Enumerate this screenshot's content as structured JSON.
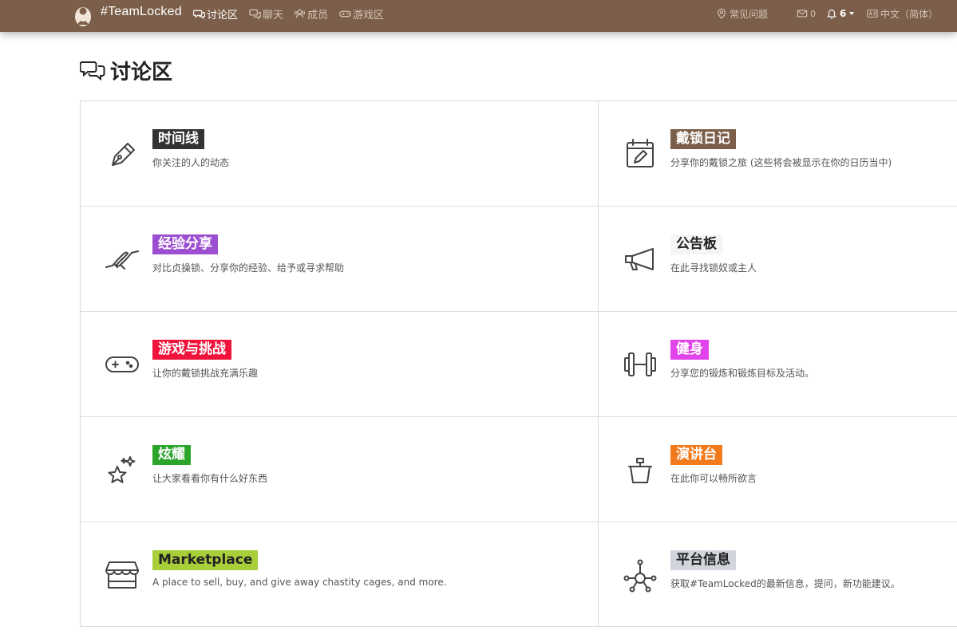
{
  "colors": {
    "topbar": "#7b5f4a",
    "nav_active": "#ffffff",
    "nav_inactive": "#d5c5b8"
  },
  "header": {
    "brand": "#TeamLocked",
    "logo_icon": "locked-person-icon",
    "nav": [
      {
        "label": "讨论区",
        "icon": "chat-bubbles-icon",
        "active": true
      },
      {
        "label": "聊天",
        "icon": "chat-icon",
        "active": false
      },
      {
        "label": "成员",
        "icon": "members-icon",
        "active": false
      },
      {
        "label": "游戏区",
        "icon": "gamepad-icon",
        "active": false
      }
    ],
    "faq": {
      "label": "常见问题",
      "icon": "map-pin-icon"
    },
    "mail": {
      "count": "0",
      "icon": "envelope-icon"
    },
    "notifications": {
      "count": "6",
      "icon": "bell-icon"
    },
    "language": {
      "label": "中文（简体）",
      "icon": "language-icon"
    }
  },
  "page": {
    "title": "讨论区",
    "title_icon": "chat-bubbles-icon"
  },
  "categories": [
    {
      "name": "时间线",
      "desc": "你关注的人的动态",
      "color": "#333333",
      "icon": "fountain-pen-icon"
    },
    {
      "name": "戴锁日记",
      "desc": "分享你的戴锁之旅 (这些将会被显示在你的日历当中)",
      "color": "#7b5f4a",
      "icon": "calendar-edit-icon"
    },
    {
      "name": "经验分享",
      "desc": "对比贞操锁、分享你的经验、给予或寻求帮助",
      "color": "#9c4fd0",
      "icon": "handshake-icon"
    },
    {
      "name": "公告板",
      "desc": "在此寻找锁奴或主人",
      "color": "#f5f5f5",
      "text_color": "#222222",
      "icon": "megaphone-icon"
    },
    {
      "name": "游戏与挑战",
      "desc": "让你的戴锁挑战充满乐趣",
      "color": "#f0143c",
      "icon": "gamepad-icon"
    },
    {
      "name": "健身",
      "desc": "分享您的锻炼和锻炼目标及活动。",
      "color": "#e044ea",
      "icon": "dumbbell-icon"
    },
    {
      "name": "炫耀",
      "desc": "让大家看看你有什么好东西",
      "color": "#2aa52a",
      "icon": "sparkle-star-icon"
    },
    {
      "name": "演讲台",
      "desc": "在此你可以畅所欲言",
      "color": "#f17a1c",
      "icon": "soapbox-icon"
    },
    {
      "name": "Marketplace",
      "desc": "A place to sell, buy, and give away chastity cages, and more.",
      "color": "#a8cf3a",
      "text_color": "#222222",
      "icon": "storefront-icon"
    },
    {
      "name": "平台信息",
      "desc": "获取#TeamLocked的最新信息，提问，新功能建议。",
      "color": "#d0d6dc",
      "text_color": "#222222",
      "icon": "network-hub-icon"
    }
  ]
}
